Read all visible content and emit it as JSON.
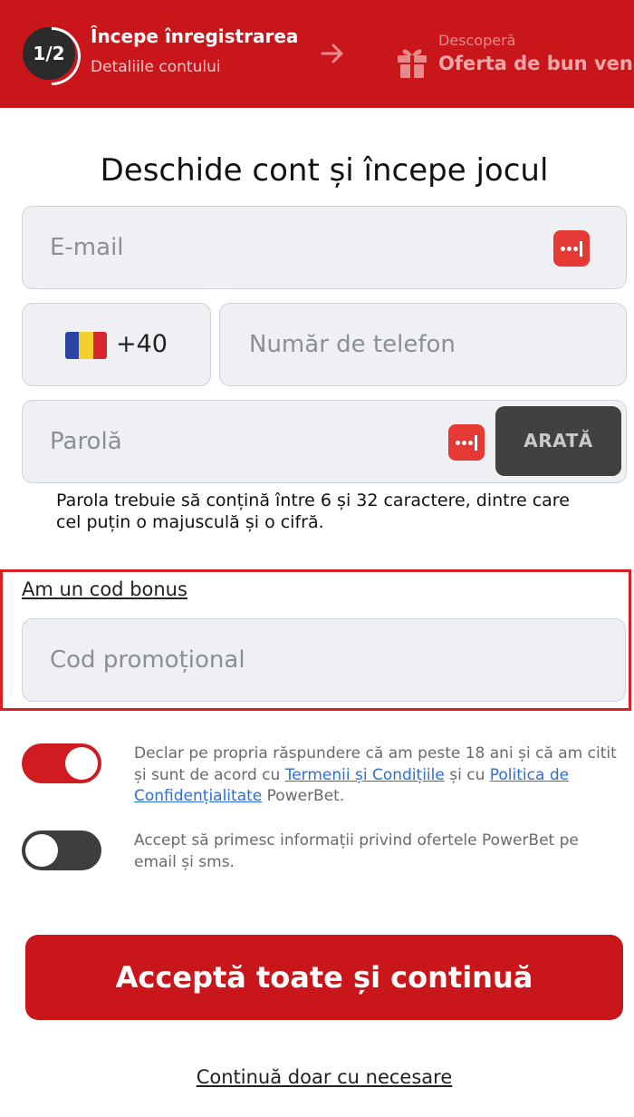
{
  "header": {
    "step_indicator": "1/2",
    "step1_title": "Începe înregistrarea",
    "step1_subtitle": "Detaliile contului",
    "step2_small": "Descoperă",
    "step2_title": "Oferta de bun venit",
    "icons": {
      "arrow": "arrow-right-icon",
      "gift": "gift-icon"
    },
    "colors": {
      "background": "#c8161b"
    }
  },
  "form": {
    "title": "Deschide cont și începe jocul",
    "email_placeholder": "E-mail",
    "country_code": "+40",
    "country_flag": "romania-flag",
    "phone_placeholder": "Număr de telefon",
    "password_placeholder": "Parolă",
    "show_password_label": "ARATĂ",
    "password_hint": "Parola trebuie să conțină între 6 și 32 caractere, dintre care cel puțin o majusculă și o cifră.",
    "bonus_link": "Am un cod bonus",
    "promo_placeholder": "Cod promoțional"
  },
  "consents": {
    "terms": {
      "checked": true,
      "text_before": "Declar pe propria răspundere că am peste 18 ani și că am citit și sunt de acord cu ",
      "terms_link": "Termenii și Condițiile",
      "text_middle": " și cu ",
      "privacy_link": "Politica de Confidențialitate",
      "text_after": " PowerBet."
    },
    "marketing": {
      "checked": false,
      "text": "Accept să primesc informații privind ofertele PowerBet pe email și sms."
    }
  },
  "actions": {
    "accept_all": "Acceptă toate și continuă",
    "continue_necessary": "Continuă doar cu necesare"
  },
  "colors": {
    "accent_red": "#c8161b",
    "link_blue": "#2d6fd6",
    "highlight_border": "#d81f26"
  }
}
